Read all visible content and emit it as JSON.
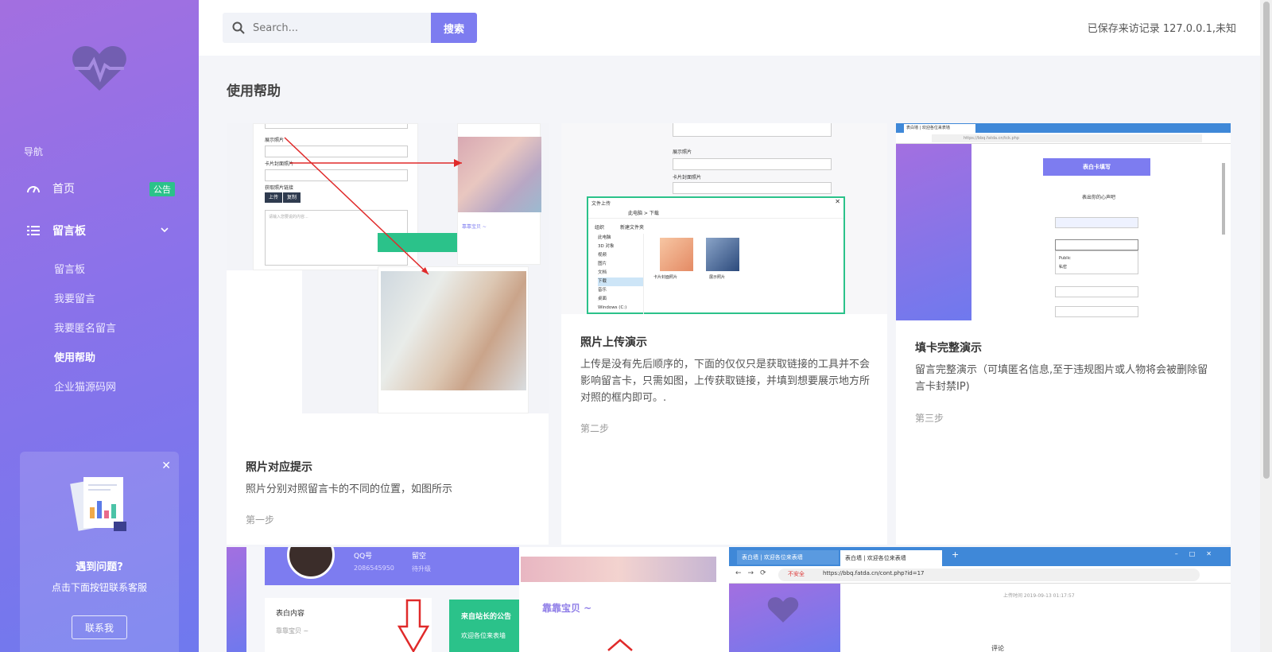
{
  "sidebar": {
    "nav_heading": "导航",
    "home_label": "首页",
    "home_badge": "公告",
    "board_label": "留言板",
    "sub_items": [
      "留言板",
      "我要留言",
      "我要匿名留言",
      "使用帮助",
      "企业猫源码网"
    ],
    "active_index": 3,
    "help": {
      "title": "遇到问题?",
      "subtitle": "点击下面按钮联系客服",
      "button": "联系我"
    }
  },
  "header": {
    "search_placeholder": "Search...",
    "search_button": "搜索",
    "visitor_text": "已保存来访记录 127.0.0.1,未知"
  },
  "page": {
    "title": "使用帮助",
    "cards": [
      {
        "title": "照片对应提示",
        "text": "照片分别对照留言卡的不同的位置，如图所示",
        "step": "第一步",
        "shot_labels": [
          "展示照片",
          "卡片封面照片",
          "获取照片链接",
          "上传",
          "复制",
          "请输入您要说的内容...",
          "靠靠宝贝 ~"
        ]
      },
      {
        "title": "照片上传演示",
        "text": "上传是没有先后顺序的，下面的仅仅只是获取链接的工具并不会影响留言卡，只需如图，上传获取链接，并填到想要展示地方所对照的框内即可。.",
        "step": "第二步",
        "shot_labels": [
          "展示照片",
          "卡片封面照片",
          "文件上传",
          "此电脑 > 下载",
          "组织",
          "新建文件夹",
          "此电脑",
          "3D 对象",
          "视频",
          "图片",
          "文档",
          "下载",
          "音乐",
          "桌面",
          "Windows (C:)",
          "卡片封面照片",
          "展示照片"
        ]
      },
      {
        "title": "填卡完整演示",
        "text": "留言完整演示（可填匿名信息,至于违规图片或人物将会被删除留言卡封禁IP)",
        "step": "第三步",
        "shot_labels": [
          "表白墙 | 欢迎各位来表墙",
          "https://bbq.fatda.cn/tck.php",
          "表白卡填写",
          "表出你的心声吧",
          "Public",
          "私密"
        ]
      }
    ],
    "bottom_shots": {
      "left_labels": [
        "QQ号",
        "留空",
        "2086545950",
        "待升级",
        "表白内容",
        "靠靠宝贝 ~",
        "来自站长的公告",
        "欢迎各位来表墙"
      ],
      "mid_labels": [
        "靠靠宝贝 ~"
      ],
      "right_labels": [
        "表白墙 | 欢迎各位来表墙",
        "表白墙 | 欢迎各位来表墙",
        "不安全",
        "https://bbq.fatda.cn/cont.php?id=17",
        "上传时间 2019-09-13 01:17:57",
        "评论"
      ]
    }
  },
  "colors": {
    "accent": "#7d7cf0",
    "badge": "#2bc28a",
    "sidebar_top": "#a36fe0",
    "sidebar_bottom": "#6f79ee"
  }
}
